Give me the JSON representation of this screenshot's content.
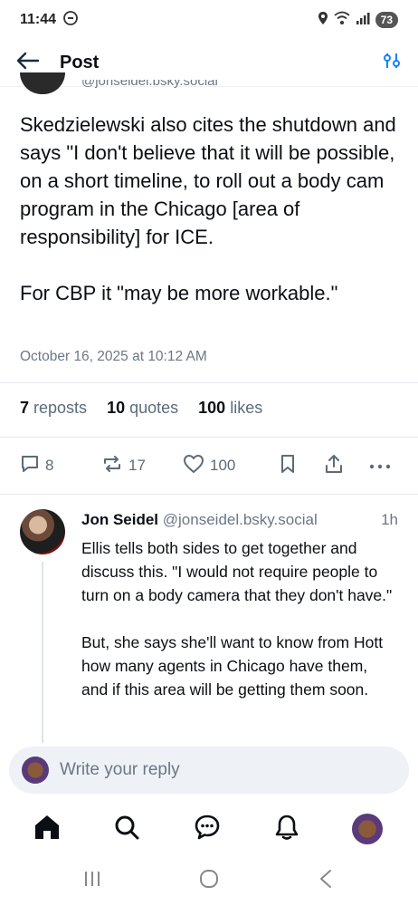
{
  "status_bar": {
    "time": "11:44",
    "battery": "73"
  },
  "header": {
    "title": "Post"
  },
  "post": {
    "clipped_handle": "@jonseidel.bsky.social",
    "text": "Skedzielewski also cites the shutdown and says \"I don't believe that it will be possible, on a short timeline, to roll out a body cam program in the Chicago [area of responsibility] for ICE.\n\nFor CBP it \"may be more workable.\"",
    "date": "October 16, 2025 at 10:12 AM",
    "stats": {
      "reposts_count": "7",
      "reposts_label": "reposts",
      "quotes_count": "10",
      "quotes_label": "quotes",
      "likes_count": "100",
      "likes_label": "likes"
    },
    "actions": {
      "replies": "8",
      "reposts": "17",
      "likes": "100"
    }
  },
  "reply": {
    "author": "Jon Seidel",
    "handle": "@jonseidel.bsky.social",
    "time": "1h",
    "text": "Ellis tells both sides to get together and discuss this. \"I would not require people to turn on a body camera that they don't have.\"\n\nBut, she says she'll want to know from Hott how many agents in Chicago have them, and if this area will be getting them soon."
  },
  "composer": {
    "placeholder": "Write your reply"
  },
  "colors": {
    "accent": "#1083fe",
    "muted": "#6b7785",
    "text": "#0b0f14"
  }
}
